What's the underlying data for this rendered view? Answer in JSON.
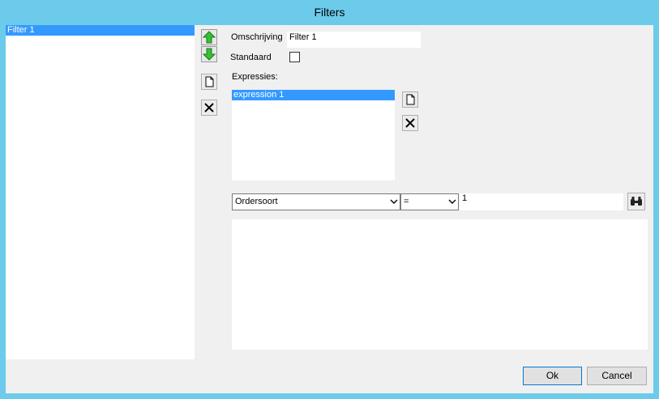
{
  "window": {
    "title": "Filters"
  },
  "filters_list": {
    "items": [
      "Filter 1"
    ]
  },
  "toolbar": {
    "move_up_icon": "arrow-up-icon",
    "move_down_icon": "arrow-down-icon",
    "new_icon": "new-document-icon",
    "delete_icon": "delete-icon"
  },
  "form": {
    "description_label": "Omschrijving",
    "description_value": "Filter 1",
    "default_label": "Standaard",
    "default_checked": false,
    "expressions_label": "Expressies:"
  },
  "expressions_list": {
    "items": [
      "expression 1"
    ]
  },
  "condition": {
    "field_value": "Ordersoort",
    "operator_value": "=",
    "value": "1",
    "search_icon": "binoculars-icon"
  },
  "buttons": {
    "ok_label": "Ok",
    "cancel_label": "Cancel"
  },
  "colors": {
    "title_bar": "#6ccbeb",
    "selection": "#3399ff",
    "dialog_bg": "#f0f0f0",
    "arrow_green": "#34c234"
  }
}
